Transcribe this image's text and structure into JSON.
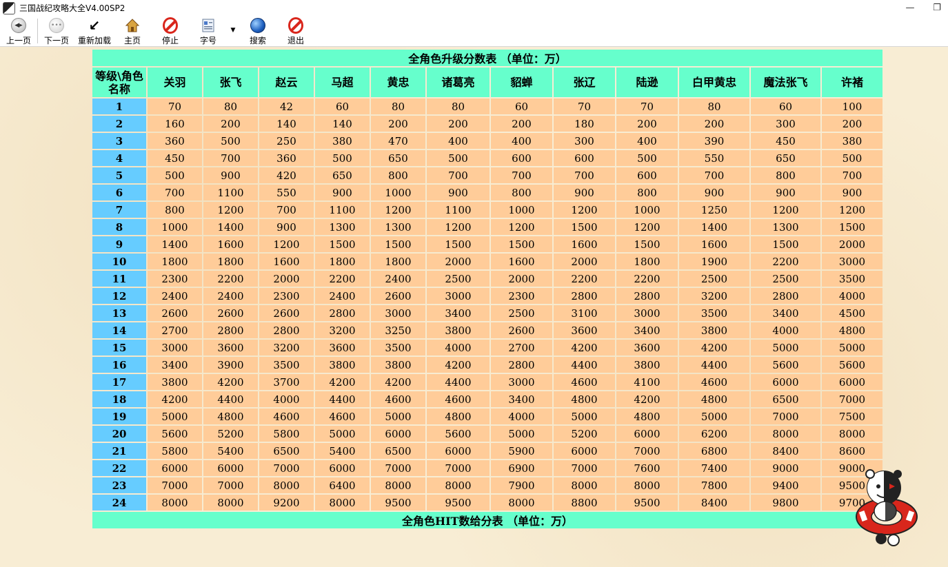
{
  "window": {
    "title": "三国战纪攻略大全V4.00SP2"
  },
  "toolbar": {
    "back": "上一页",
    "forward": "下一页",
    "reload": "重新加载",
    "home": "主页",
    "stop": "停止",
    "font": "字号",
    "search": "搜索",
    "exit": "退出"
  },
  "table1": {
    "title": "全角色升级分数表 （单位：万）",
    "corner_header": "等级\\角色名称",
    "characters": [
      "关羽",
      "张飞",
      "赵云",
      "马超",
      "黄忠",
      "诸葛亮",
      "貂蝉",
      "张辽",
      "陆逊",
      "白甲黄忠",
      "魔法张飞",
      "许褚"
    ],
    "rows": [
      {
        "level": "1",
        "values": [
          "70",
          "80",
          "42",
          "60",
          "80",
          "80",
          "60",
          "70",
          "70",
          "80",
          "60",
          "100"
        ]
      },
      {
        "level": "2",
        "values": [
          "160",
          "200",
          "140",
          "140",
          "200",
          "200",
          "200",
          "180",
          "200",
          "200",
          "300",
          "200"
        ]
      },
      {
        "level": "3",
        "values": [
          "360",
          "500",
          "250",
          "380",
          "470",
          "400",
          "400",
          "300",
          "400",
          "390",
          "450",
          "380"
        ]
      },
      {
        "level": "4",
        "values": [
          "450",
          "700",
          "360",
          "500",
          "650",
          "500",
          "600",
          "600",
          "500",
          "550",
          "650",
          "500"
        ]
      },
      {
        "level": "5",
        "values": [
          "500",
          "900",
          "420",
          "650",
          "800",
          "700",
          "700",
          "700",
          "600",
          "700",
          "800",
          "700"
        ]
      },
      {
        "level": "6",
        "values": [
          "700",
          "1100",
          "550",
          "900",
          "1000",
          "900",
          "800",
          "900",
          "800",
          "900",
          "900",
          "900"
        ]
      },
      {
        "level": "7",
        "values": [
          "800",
          "1200",
          "700",
          "1100",
          "1200",
          "1100",
          "1000",
          "1200",
          "1000",
          "1250",
          "1200",
          "1200"
        ]
      },
      {
        "level": "8",
        "values": [
          "1000",
          "1400",
          "900",
          "1300",
          "1300",
          "1200",
          "1200",
          "1500",
          "1200",
          "1400",
          "1300",
          "1500"
        ]
      },
      {
        "level": "9",
        "values": [
          "1400",
          "1600",
          "1200",
          "1500",
          "1500",
          "1500",
          "1500",
          "1600",
          "1500",
          "1600",
          "1500",
          "2000"
        ]
      },
      {
        "level": "10",
        "values": [
          "1800",
          "1800",
          "1600",
          "1800",
          "1800",
          "2000",
          "1600",
          "2000",
          "1800",
          "1900",
          "2200",
          "3000"
        ]
      },
      {
        "level": "11",
        "values": [
          "2300",
          "2200",
          "2000",
          "2200",
          "2400",
          "2500",
          "2000",
          "2200",
          "2200",
          "2500",
          "2500",
          "3500"
        ]
      },
      {
        "level": "12",
        "values": [
          "2400",
          "2400",
          "2300",
          "2400",
          "2600",
          "3000",
          "2300",
          "2800",
          "2800",
          "3200",
          "2800",
          "4000"
        ]
      },
      {
        "level": "13",
        "values": [
          "2600",
          "2600",
          "2600",
          "2800",
          "3000",
          "3400",
          "2500",
          "3100",
          "3000",
          "3500",
          "3400",
          "4500"
        ]
      },
      {
        "level": "14",
        "values": [
          "2700",
          "2800",
          "2800",
          "3200",
          "3250",
          "3800",
          "2600",
          "3600",
          "3400",
          "3800",
          "4000",
          "4800"
        ]
      },
      {
        "level": "15",
        "values": [
          "3000",
          "3600",
          "3200",
          "3600",
          "3500",
          "4000",
          "2700",
          "4200",
          "3600",
          "4200",
          "5000",
          "5000"
        ]
      },
      {
        "level": "16",
        "values": [
          "3400",
          "3900",
          "3500",
          "3800",
          "3800",
          "4200",
          "2800",
          "4400",
          "3800",
          "4400",
          "5600",
          "5600"
        ]
      },
      {
        "level": "17",
        "values": [
          "3800",
          "4200",
          "3700",
          "4200",
          "4200",
          "4400",
          "3000",
          "4600",
          "4100",
          "4600",
          "6000",
          "6000"
        ]
      },
      {
        "level": "18",
        "values": [
          "4200",
          "4400",
          "4000",
          "4400",
          "4600",
          "4600",
          "3400",
          "4800",
          "4200",
          "4800",
          "6500",
          "7000"
        ]
      },
      {
        "level": "19",
        "values": [
          "5000",
          "4800",
          "4600",
          "4600",
          "5000",
          "4800",
          "4000",
          "5000",
          "4800",
          "5000",
          "7000",
          "7500"
        ]
      },
      {
        "level": "20",
        "values": [
          "5600",
          "5200",
          "5800",
          "5000",
          "6000",
          "5600",
          "5000",
          "5200",
          "6000",
          "6200",
          "8000",
          "8000"
        ]
      },
      {
        "level": "21",
        "values": [
          "5800",
          "5400",
          "6500",
          "5400",
          "6500",
          "6000",
          "5900",
          "6000",
          "7000",
          "6800",
          "8400",
          "8600"
        ]
      },
      {
        "level": "22",
        "values": [
          "6000",
          "6000",
          "7000",
          "6000",
          "7000",
          "7000",
          "6900",
          "7000",
          "7600",
          "7400",
          "9000",
          "9000"
        ]
      },
      {
        "level": "23",
        "values": [
          "7000",
          "7000",
          "8000",
          "6400",
          "8000",
          "8000",
          "7900",
          "8000",
          "8000",
          "7800",
          "9400",
          "9500"
        ]
      },
      {
        "level": "24",
        "values": [
          "8000",
          "8000",
          "9200",
          "8000",
          "9500",
          "9500",
          "8000",
          "8800",
          "9500",
          "8400",
          "9800",
          "9700"
        ]
      }
    ]
  },
  "table2": {
    "title": "全角色HIT数给分表 （单位：万）"
  }
}
